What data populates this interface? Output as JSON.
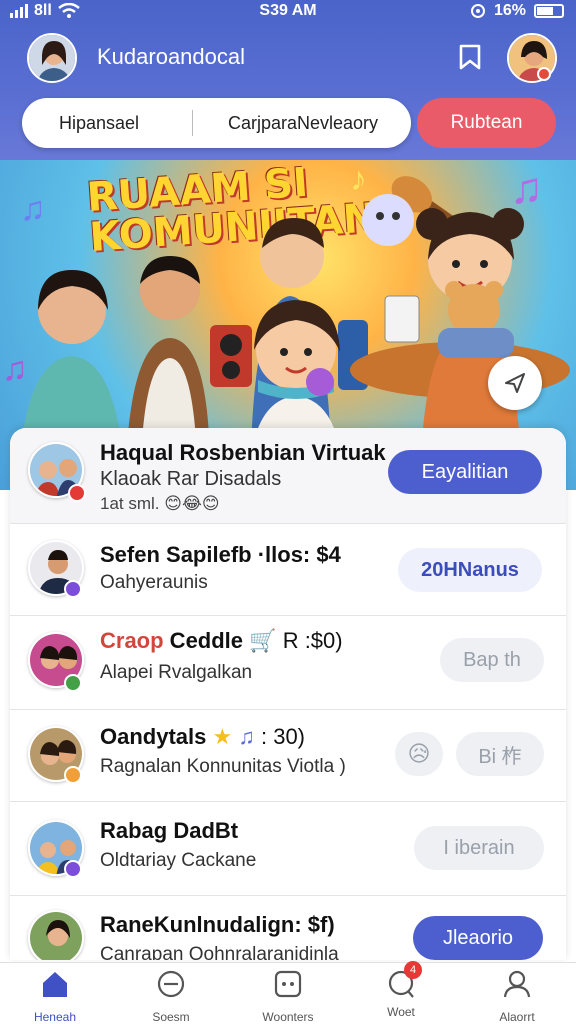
{
  "status_bar": {
    "carrier": "8ll",
    "time": "S39 AM",
    "battery": "16%"
  },
  "header": {
    "title": "Kudaroandocal"
  },
  "search": {
    "tabs": [
      "Hipansael",
      "Carjpara",
      "Nevleaory"
    ],
    "action": "Rubtean"
  },
  "hero": {
    "title_line1": "RUAAM SI",
    "title_line2": "KOMUNIITAN"
  },
  "list": [
    {
      "title": "Haqual Rosbenbian Virtuak",
      "subtitle": "Klaoak Rar Disadals",
      "meta": "1at sml.",
      "button": "Eayalitian",
      "button_style": "primary"
    },
    {
      "title": "Sefen Sapilefb ·llos: $4",
      "subtitle": "Oahyeraunis",
      "button": "20HNanus",
      "button_style": "ghost-blue"
    },
    {
      "title_accent": "Craop",
      "title": " Ceddle",
      "title_tail": "R :$0)",
      "subtitle": "Alapei Rvalgalkan",
      "button": "Bap th",
      "button_style": "ghost"
    },
    {
      "title": "Oandytals",
      "title_tail": ": 30)",
      "subtitle": "Ragnalan Konnunitas Viotla )",
      "button": "Bi 柞",
      "button_style": "ghost"
    },
    {
      "title": "Rabag DadBt",
      "subtitle": "Oldtariay Cackane",
      "button": "I iberain",
      "button_style": "ghost"
    },
    {
      "title": "RaneKunlnudalign: $f)",
      "subtitle": "Canrapan Oohnralaranidinla",
      "button": "Jleaorio",
      "button_style": "primary"
    }
  ],
  "bottom_nav": [
    {
      "label": "Heneah",
      "icon": "home-icon",
      "active": true
    },
    {
      "label": "Soesm",
      "icon": "search-icon",
      "active": false
    },
    {
      "label": "Woonters",
      "icon": "dice-icon",
      "active": false
    },
    {
      "label": "Woet",
      "icon": "chat-icon",
      "active": false,
      "badge": "4"
    },
    {
      "label": "Alaorrt",
      "icon": "user-icon",
      "active": false
    }
  ],
  "colors": {
    "header": "#4a64c9",
    "accent_red": "#ea5b69",
    "primary_button": "#4d5fcf",
    "nav_active": "#3f51c4"
  }
}
